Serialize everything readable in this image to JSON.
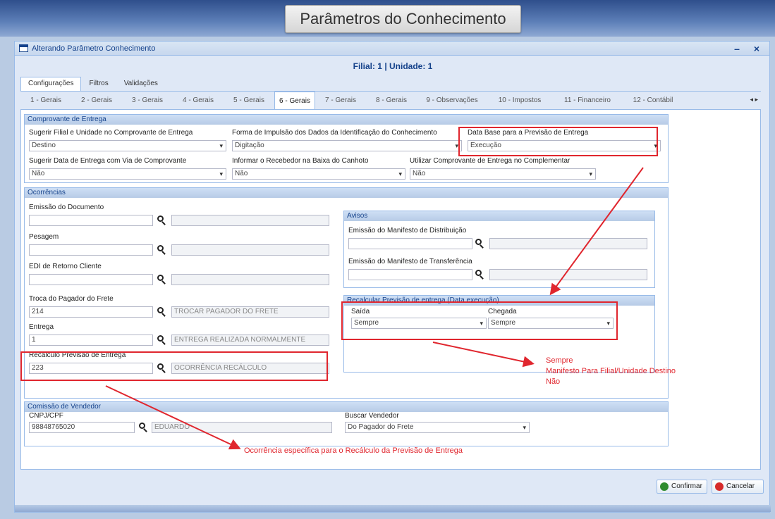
{
  "banner_title": "Parâmetros do Conhecimento",
  "window": {
    "title": "Alterando Parâmetro Conhecimento",
    "tools": "– ×"
  },
  "filial_line": "Filial: 1 | Unidade: 1",
  "main_tabs": [
    "Configurações",
    "Filtros",
    "Validações"
  ],
  "sub_tabs": [
    "1 - Gerais",
    "2 - Gerais",
    "3 - Gerais",
    "4 - Gerais",
    "5 - Gerais",
    "6 - Gerais",
    "7 - Gerais",
    "8 - Gerais",
    "9 - Observações",
    "10 - Impostos",
    "11 - Financeiro",
    "12 - Contábil"
  ],
  "sub_tabs_arrows": "◂ ▸",
  "comprovante": {
    "title": "Comprovante de Entrega",
    "f1_label": "Sugerir Filial e Unidade no Comprovante de Entrega",
    "f1_value": "Destino",
    "f2_label": "Forma de Impulsão dos Dados da Identificação do Conhecimento",
    "f2_value": "Digitação",
    "f3_label": "Data Base para a Previsão de Entrega",
    "f3_value": "Execução",
    "f4_label": "Sugerir Data de Entrega com Via de Comprovante",
    "f4_value": "Não",
    "f5_label": "Informar o Recebedor na Baixa do Canhoto",
    "f5_value": "Não",
    "f6_label": "Utilizar Comprovante de Entrega no Complementar",
    "f6_value": "Não"
  },
  "ocorrencias": {
    "title": "Ocorrências",
    "emissao_label": "Emissão do Documento",
    "emissao_code": "",
    "emissao_desc": "",
    "pesagem_label": "Pesagem",
    "pesagem_code": "",
    "pesagem_desc": "",
    "edi_label": "EDI de Retorno Cliente",
    "edi_code": "",
    "edi_desc": "",
    "troca_label": "Troca do Pagador do Frete",
    "troca_code": "214",
    "troca_desc": "TROCAR PAGADOR DO FRETE",
    "entrega_label": "Entrega",
    "entrega_code": "1",
    "entrega_desc": "ENTREGA REALIZADA NORMALMENTE",
    "recalc_label": "Recálculo Previsão de Entrega",
    "recalc_code": "223",
    "recalc_desc": "OCORRÊNCIA RECÁLCULO"
  },
  "avisos": {
    "title": "Avisos",
    "dist_label": "Emissão do Manifesto de Distribuição",
    "dist_code": "",
    "dist_desc": "",
    "transf_label": "Emissão do Manifesto de Transferência",
    "transf_code": "",
    "transf_desc": ""
  },
  "recalcular": {
    "title": "Recalcular Previsão de entrega (Data execução)",
    "saida_label": "Saída",
    "saida_value": "Sempre",
    "chegada_label": "Chegada",
    "chegada_value": "Sempre"
  },
  "comissao": {
    "title": "Comissão de Vendedor",
    "cnpj_label": "CNPJ/CPF",
    "cnpj_value": "98848765020",
    "vendedor_name": "EDUARDO",
    "buscar_label": "Buscar Vendedor",
    "buscar_value": "Do Pagador do Frete"
  },
  "annotations": {
    "note_options_1": "Sempre",
    "note_options_2": "Manifesto Para Filial/Unidade Destino",
    "note_options_3": "Não",
    "note_ocorrencia": "Ocorrência específica para o Recálculo da Previsão de Entrega"
  },
  "buttons": {
    "confirm": "Confirmar",
    "cancel": "Cancelar"
  },
  "colors": {
    "accent": "#15428b",
    "annotation": "#e0262e",
    "confirm_icon": "#2e8b2e",
    "cancel_icon": "#d62b2b"
  }
}
